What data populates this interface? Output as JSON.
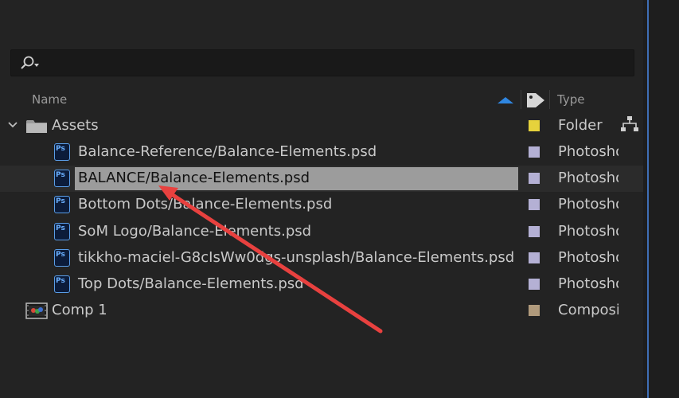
{
  "search": {
    "placeholder": ""
  },
  "columns": {
    "name": "Name",
    "type": "Type"
  },
  "items": [
    {
      "name": "Assets",
      "type": "Folder",
      "kind": "folder",
      "label_color": "#e6d23c"
    },
    {
      "name": "Balance-Reference/Balance-Elements.psd",
      "type": "Photoshop",
      "kind": "psd",
      "label_color": "#b4b0d4"
    },
    {
      "name": "BALANCE/Balance-Elements.psd",
      "type": "Photoshop",
      "kind": "psd",
      "label_color": "#b4b0d4",
      "selected": true
    },
    {
      "name": "Bottom Dots/Balance-Elements.psd",
      "type": "Photoshop",
      "kind": "psd",
      "label_color": "#b4b0d4"
    },
    {
      "name": "SoM Logo/Balance-Elements.psd",
      "type": "Photoshop",
      "kind": "psd",
      "label_color": "#b4b0d4"
    },
    {
      "name": "tikkho-maciel-G8cIsWw0dgs-unsplash/Balance-Elements.psd",
      "type": "Photoshop",
      "kind": "psd",
      "label_color": "#b4b0d4"
    },
    {
      "name": "Top Dots/Balance-Elements.psd",
      "type": "Photoshop",
      "kind": "psd",
      "label_color": "#b4b0d4"
    },
    {
      "name": "Comp 1",
      "type": "Composition",
      "kind": "comp",
      "label_color": "#b09a7c"
    }
  ],
  "annotation": {
    "arrow_color": "#e8413f"
  }
}
